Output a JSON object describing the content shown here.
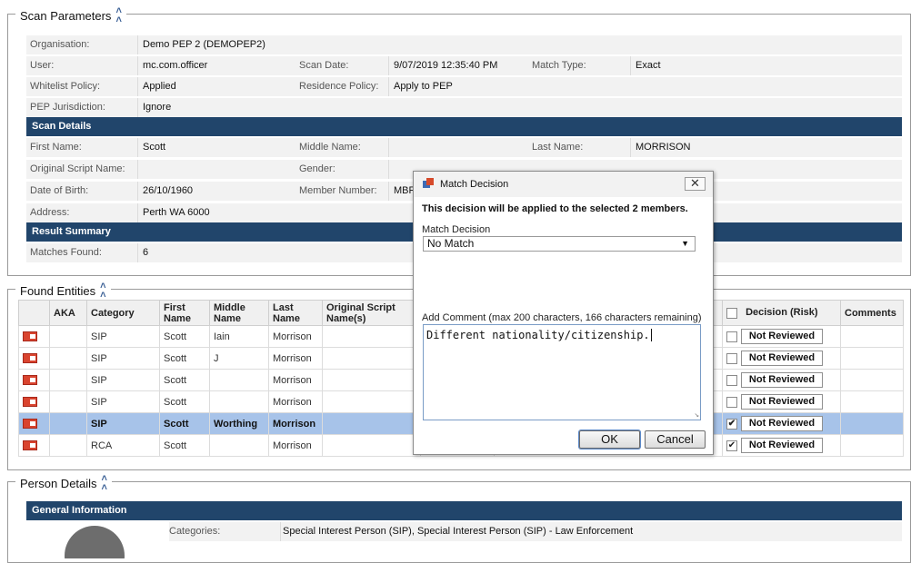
{
  "scan_parameters": {
    "legend": "Scan Parameters",
    "organisation_label": "Organisation:",
    "organisation_value": "Demo PEP 2 (DEMOPEP2)",
    "user_label": "User:",
    "user_value": "mc.com.officer",
    "scan_date_label": "Scan Date:",
    "scan_date_value": "9/07/2019 12:35:40 PM",
    "match_type_label": "Match Type:",
    "match_type_value": "Exact",
    "whitelist_label": "Whitelist Policy:",
    "whitelist_value": "Applied",
    "residence_label": "Residence Policy:",
    "residence_value": "Apply to PEP",
    "pep_jurisdiction_label": "PEP Jurisdiction:",
    "pep_jurisdiction_value": "Ignore"
  },
  "scan_details": {
    "header": "Scan Details",
    "first_name_label": "First Name:",
    "first_name_value": "Scott",
    "middle_name_label": "Middle Name:",
    "middle_name_value": "",
    "last_name_label": "Last Name:",
    "last_name_value": "MORRISON",
    "original_script_label": "Original Script Name:",
    "gender_label": "Gender:",
    "dob_label": "Date of Birth:",
    "dob_value": "26/10/1960",
    "member_number_label": "Member Number:",
    "member_number_value": "MBR",
    "address_label": "Address:",
    "address_value": "Perth WA 6000"
  },
  "result_summary": {
    "header": "Result Summary",
    "matches_label": "Matches Found:",
    "matches_value": "6"
  },
  "found_entities": {
    "legend": "Found Entities",
    "columns": {
      "aka": "AKA",
      "category": "Category",
      "first_name": "First Name",
      "middle_name": "Middle Name",
      "last_name": "Last Name",
      "original_script": "Original Script Name(s)",
      "decision": "Decision (Risk)",
      "comments": "Comments"
    },
    "rows": [
      {
        "category": "SIP",
        "first": "Scott",
        "middle": "Iain",
        "last": "Morrison",
        "checked": "",
        "decision": "Not Reviewed"
      },
      {
        "category": "SIP",
        "first": "Scott",
        "middle": "J",
        "last": "Morrison",
        "checked": "",
        "decision": "Not Reviewed"
      },
      {
        "category": "SIP",
        "first": "Scott",
        "middle": "",
        "last": "Morrison",
        "checked": "",
        "decision": "Not Reviewed"
      },
      {
        "category": "SIP",
        "first": "Scott",
        "middle": "",
        "last": "Morrison",
        "checked": "",
        "decision": "Not Reviewed"
      },
      {
        "category": "SIP",
        "first": "Scott",
        "middle": "Worthing",
        "last": "Morrison",
        "checked": "✔",
        "decision": "Not Reviewed"
      },
      {
        "category": "RCA",
        "first": "Scott",
        "middle": "",
        "last": "Morrison",
        "checked": "✔",
        "decision": "Not Reviewed"
      }
    ]
  },
  "person_details": {
    "legend": "Person Details",
    "general_header": "General Information",
    "categories_label": "Categories:",
    "categories_value": "Special Interest Person (SIP), Special Interest Person (SIP) - Law Enforcement"
  },
  "modal": {
    "title": "Match Decision",
    "close_glyph": "✕",
    "info": "This decision will be applied to the selected 2 members.",
    "decision_label": "Match Decision",
    "decision_value": "No Match",
    "comment_label": "Add Comment (max 200 characters, 166 characters remaining)",
    "comment_value": "Different nationality/citizenship.",
    "ok_label": "OK",
    "cancel_label": "Cancel"
  },
  "colors": {
    "section_bar": "#21456b",
    "selected_row": "#a7c3e9",
    "flag_icon": "#d9442f"
  }
}
